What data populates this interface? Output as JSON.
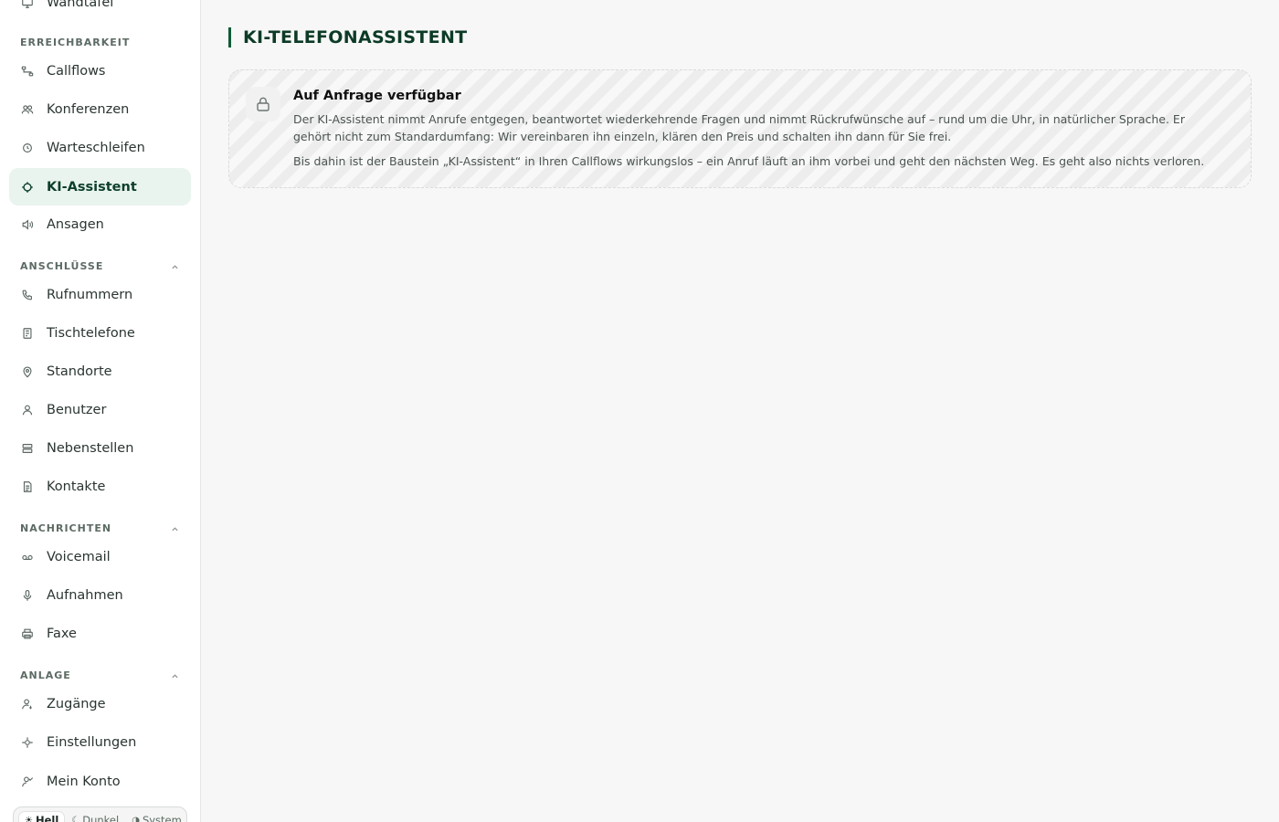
{
  "sidebar": {
    "top_item": {
      "label": "Wandtafel",
      "icon": "monitor-icon"
    },
    "sections": [
      {
        "title": "ERREICHBARKEIT",
        "collapsible": false,
        "items": [
          {
            "label": "Callflows",
            "icon": "flow-icon"
          },
          {
            "label": "Konferenzen",
            "icon": "users-icon"
          },
          {
            "label": "Warteschleifen",
            "icon": "clock-icon"
          },
          {
            "label": "KI-Assistent",
            "icon": "ai-icon",
            "active": true
          },
          {
            "label": "Ansagen",
            "icon": "speaker-icon"
          }
        ]
      },
      {
        "title": "ANSCHLÜSSE",
        "collapsible": true,
        "items": [
          {
            "label": "Rufnummern",
            "icon": "phone-icon"
          },
          {
            "label": "Tischtelefone",
            "icon": "desk-phone-icon"
          },
          {
            "label": "Standorte",
            "icon": "map-pin-icon"
          },
          {
            "label": "Benutzer",
            "icon": "user-icon"
          },
          {
            "label": "Nebenstellen",
            "icon": "server-icon"
          },
          {
            "label": "Kontakte",
            "icon": "contacts-icon"
          }
        ]
      },
      {
        "title": "NACHRICHTEN",
        "collapsible": true,
        "items": [
          {
            "label": "Voicemail",
            "icon": "voicemail-icon"
          },
          {
            "label": "Aufnahmen",
            "icon": "mic-icon"
          },
          {
            "label": "Faxe",
            "icon": "printer-icon"
          }
        ]
      },
      {
        "title": "ANLAGE",
        "collapsible": true,
        "items": [
          {
            "label": "Zugänge",
            "icon": "user-key-icon"
          },
          {
            "label": "Einstellungen",
            "icon": "settings-icon"
          },
          {
            "label": "Mein Konto",
            "icon": "user-check-icon"
          }
        ]
      }
    ],
    "theme": {
      "options": [
        {
          "label": "Hell",
          "icon": "☀",
          "selected": true
        },
        {
          "label": "Dunkel",
          "icon": "☾",
          "selected": false
        },
        {
          "label": "System",
          "icon": "◑",
          "selected": false
        }
      ]
    }
  },
  "main": {
    "title": "KI-TELEFONASSISTENT",
    "card": {
      "icon": "lock-icon",
      "title": "Auf Anfrage verfügbar",
      "paragraph1": "Der KI-Assistent nimmt Anrufe entgegen, beantwortet wiederkehrende Fragen und nimmt Rückrufwünsche auf – rund um die Uhr, in natürlicher Sprache. Er gehört nicht zum Standardumfang: Wir vereinbaren ihn einzeln, klären den Preis und schalten ihn dann für Sie frei.",
      "paragraph2": "Bis dahin ist der Baustein „KI-Assistent“ in Ihren Callflows wirkungslos – ein Anruf läuft an ihm vorbei und geht den nächsten Weg. Es geht also nichts verloren."
    }
  },
  "colors": {
    "accent": "#0f5a37",
    "active_bg": "#e9f4ee",
    "title_color": "#0c3b26"
  }
}
